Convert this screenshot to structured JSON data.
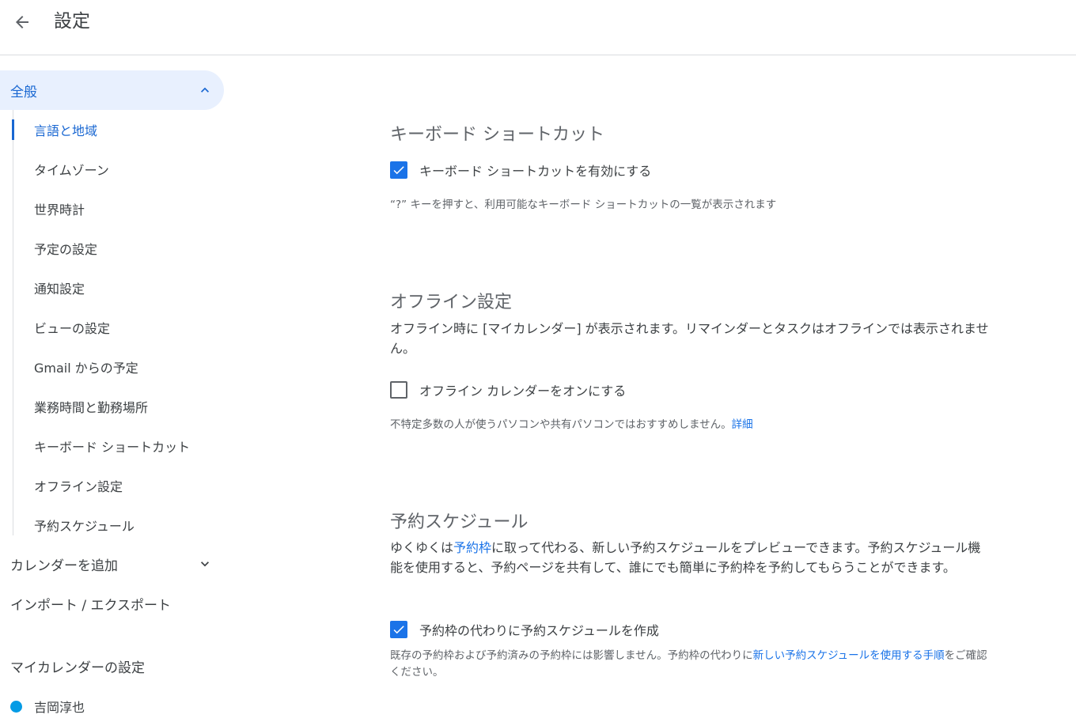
{
  "header": {
    "title": "設定"
  },
  "sidebar": {
    "general_label": "全般",
    "sub_items": [
      "言語と地域",
      "タイムゾーン",
      "世界時計",
      "予定の設定",
      "通知設定",
      "ビューの設定",
      "Gmail からの予定",
      "業務時間と勤務場所",
      "キーボード ショートカット",
      "オフライン設定",
      "予約スケジュール"
    ],
    "add_calendar_label": "カレンダーを追加",
    "import_export_label": "インポート / エクスポート",
    "my_calendars_heading": "マイカレンダーの設定",
    "calendar_name": "吉岡淳也",
    "calendar_color": "#039be5"
  },
  "main": {
    "keyboard": {
      "title": "キーボード ショートカット",
      "checkbox_label": "キーボード ショートカットを有効にする",
      "checked": true,
      "hint": "“?” キーを押すと、利用可能なキーボード ショートカットの一覧が表示されます"
    },
    "offline": {
      "title": "オフライン設定",
      "description": "オフライン時に [マイカレンダー] が表示されます。リマインダーとタスクはオフラインでは表示されません。",
      "checkbox_label": "オフライン カレンダーをオンにする",
      "checked": false,
      "hint_text": "不特定多数の人が使うパソコンや共有パソコンではおすすめしません。",
      "hint_link": "詳細"
    },
    "booking": {
      "title": "予約スケジュール",
      "desc_part1": "ゆくゆくは",
      "desc_link": "予約枠",
      "desc_part2": "に取って代わる、新しい予約スケジュールをプレビューできます。予約スケジュール機能を使用すると、予約ページを共有して、誰にでも簡単に予約枠を予約してもらうことができます。",
      "checkbox_label": "予約枠の代わりに予約スケジュールを作成",
      "checked": true,
      "hint_part1": "既存の予約枠および予約済みの予約枠には影響しません。予約枠の代わりに",
      "hint_link": "新しい予約スケジュールを使用する手順",
      "hint_part2": "をご確認ください。"
    }
  },
  "colors": {
    "accent": "#1a73e8",
    "active_nav_bg": "#e8f0fe",
    "active_text": "#1967d2"
  }
}
